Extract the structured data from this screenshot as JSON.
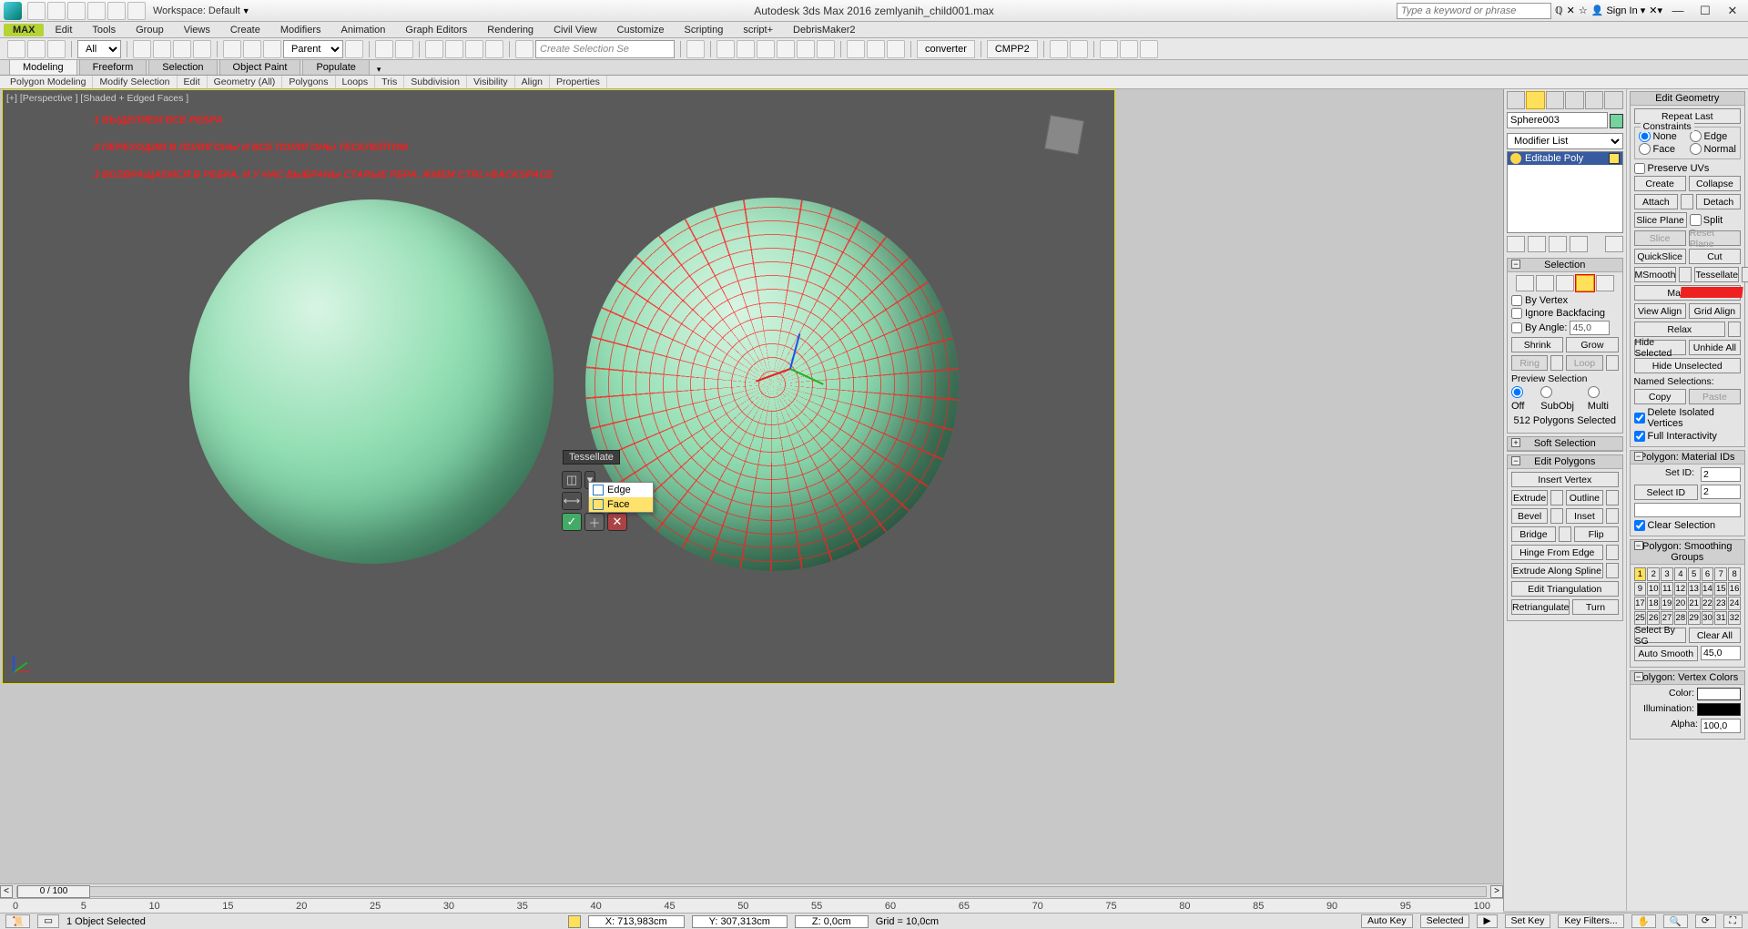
{
  "title": "Autodesk 3ds Max 2016   zemlyanih_child001.max",
  "workspace_label": "Workspace: Default",
  "search_placeholder": "Type a keyword or phrase",
  "signin": "Sign In",
  "menu": [
    "MAX",
    "Edit",
    "Tools",
    "Group",
    "Views",
    "Create",
    "Modifiers",
    "Animation",
    "Graph Editors",
    "Rendering",
    "Civil View",
    "Customize",
    "Scripting",
    "script+",
    "DebrisMaker2"
  ],
  "toolbar": {
    "all": "All",
    "parent": "Parent",
    "create_sel": "Create Selection Se",
    "converter": "converter",
    "cmpp": "CMPP2"
  },
  "ribbon_tabs": [
    "Modeling",
    "Freeform",
    "Selection",
    "Object Paint",
    "Populate"
  ],
  "ribbon_sub": [
    "Polygon Modeling",
    "Modify Selection",
    "Edit",
    "Geometry (All)",
    "Polygons",
    "Loops",
    "Tris",
    "Subdivision",
    "Visibility",
    "Align",
    "Properties"
  ],
  "viewport_label": "[+] [Perspective ] [Shaded + Edged Faces ]",
  "annotation": {
    "l1": "1 ВЫДЕЛЯЕМ ВСЕ РЕБРА",
    "l2": "2 ПЕРЕХОДИМ В ПОЛИГОНЫ И ВСЕ ПОЛИГОНЫ ТЕСЕЛЕЙТИМ",
    "l3": "3 ВОЗВРАЩАЕМСЯ В РЕБРА, И У НАС ВЫБРАНЫ СТАРЫЕ РБРА. ЖМЕМ CTRL+BACKSPACE"
  },
  "tess_tooltip": "Tessellate",
  "tess_menu": {
    "edge": "Edge",
    "face": "Face"
  },
  "modpanel": {
    "object_name": "Sphere003",
    "modifier_list": "Modifier List",
    "stack_item": "Editable Poly",
    "selection_hdr": "Selection",
    "by_vertex": "By Vertex",
    "ignore_backfacing": "Ignore Backfacing",
    "by_angle": "By Angle:",
    "angle_val": "45,0",
    "shrink": "Shrink",
    "grow": "Grow",
    "ring": "Ring",
    "loop": "Loop",
    "preview_sel": "Preview Selection",
    "off": "Off",
    "subobj": "SubObj",
    "multi": "Multi",
    "sel_count": "512 Polygons Selected",
    "soft_sel": "Soft Selection",
    "edit_polys": "Edit Polygons",
    "insert_vertex": "Insert Vertex",
    "extrude": "Extrude",
    "outline": "Outline",
    "bevel": "Bevel",
    "inset": "Inset",
    "bridge": "Bridge",
    "flip": "Flip",
    "hinge": "Hinge From Edge",
    "ext_spline": "Extrude Along Spline",
    "edit_tri": "Edit Triangulation",
    "retri": "Retriangulate",
    "turn": "Turn"
  },
  "editgeom": {
    "hdr": "Edit Geometry",
    "repeat": "Repeat Last",
    "constraints": "Constraints",
    "none": "None",
    "edge": "Edge",
    "face": "Face",
    "normal": "Normal",
    "preserve_uv": "Preserve UVs",
    "create": "Create",
    "collapse": "Collapse",
    "attach": "Attach",
    "detach": "Detach",
    "slice_plane": "Slice Plane",
    "split": "Split",
    "slice": "Slice",
    "reset_plane": "Reset Plane",
    "quickslice": "QuickSlice",
    "cut": "Cut",
    "msmooth": "MSmooth",
    "tessellate": "Tessellate",
    "make_planar": "Make Pla",
    "view_align": "View Align",
    "grid_align": "Grid Align",
    "relax": "Relax",
    "hide_sel": "Hide Selected",
    "unhide": "Unhide All",
    "hide_unsel": "Hide Unselected",
    "named_sel": "Named Selections:",
    "copy": "Copy",
    "paste": "Paste",
    "del_iso": "Delete Isolated Vertices",
    "full_int": "Full Interactivity",
    "matids_hdr": "Polygon: Material IDs",
    "set_id": "Set ID:",
    "id_val": "2",
    "sel_id": "Select ID",
    "id_val2": "2",
    "clear_sel": "Clear Selection",
    "sg_hdr": "Polygon: Smoothing Groups",
    "sel_by_sg": "Select By SG",
    "clear_all": "Clear All",
    "auto_smooth": "Auto Smooth",
    "as_val": "45,0",
    "vc_hdr": "Polygon: Vertex Colors",
    "color": "Color:",
    "illum": "Illumination:",
    "alpha": "Alpha:",
    "alpha_val": "100,0"
  },
  "timeline": {
    "pos": "0 / 100",
    "ticks": [
      "0",
      "5",
      "10",
      "15",
      "20",
      "25",
      "30",
      "35",
      "40",
      "45",
      "50",
      "55",
      "60",
      "65",
      "70",
      "75",
      "80",
      "85",
      "90",
      "95",
      "100"
    ]
  },
  "status": {
    "objsel": "1 Object Selected",
    "x": "X: 713,983cm",
    "y": "Y: 307,313cm",
    "z": "Z: 0,0cm",
    "grid": "Grid = 10,0cm",
    "autokey": "Auto Key",
    "selected": "Selected",
    "setkey": "Set Key",
    "keyfilters": "Key Filters..."
  }
}
